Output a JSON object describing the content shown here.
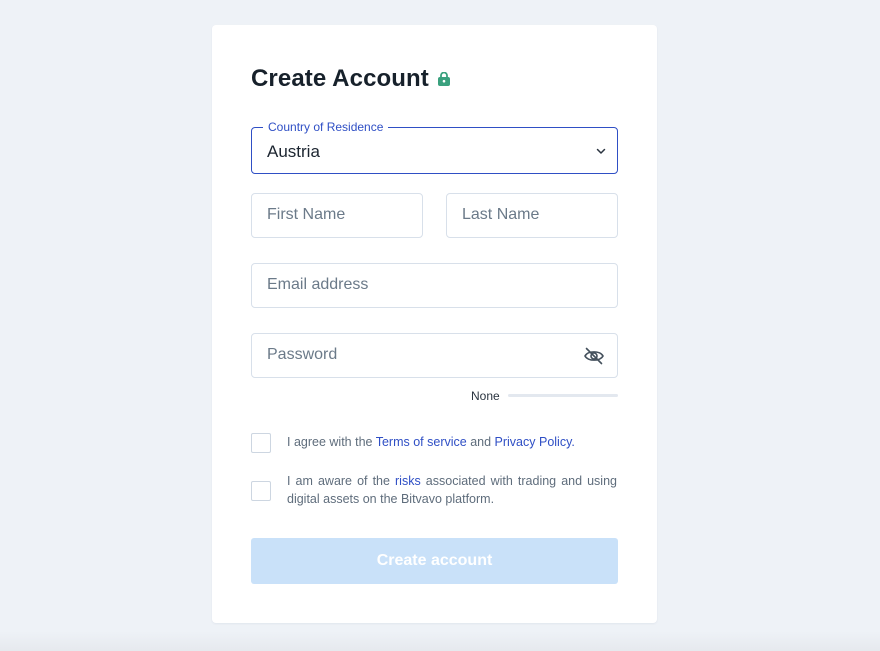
{
  "page": {
    "title": "Create Account"
  },
  "form": {
    "country": {
      "legend": "Country of Residence",
      "value": "Austria"
    },
    "first_name": {
      "placeholder": "First Name",
      "value": ""
    },
    "last_name": {
      "placeholder": "Last Name",
      "value": ""
    },
    "email": {
      "placeholder": "Email address",
      "value": ""
    },
    "password": {
      "placeholder": "Password",
      "value": "",
      "strength_label": "None",
      "strength": 0
    },
    "terms": {
      "prefix": "I agree with the ",
      "terms_link": "Terms of service",
      "middle": " and ",
      "privacy_link": "Privacy Policy",
      "suffix": "."
    },
    "risks": {
      "prefix": "I am aware of the ",
      "risks_link": "risks",
      "suffix": " associated with trading and using digital assets on the Bitvavo platform."
    },
    "submit_label": "Create account"
  },
  "colors": {
    "accent": "#2f4fc5",
    "lock_icon": "#3aa17e",
    "button_disabled": "#c9e1f9",
    "background": "#eef2f7"
  },
  "icons": {
    "title": "lock-icon",
    "select": "chevron-down-icon",
    "password_toggle": "eye-off-icon"
  }
}
